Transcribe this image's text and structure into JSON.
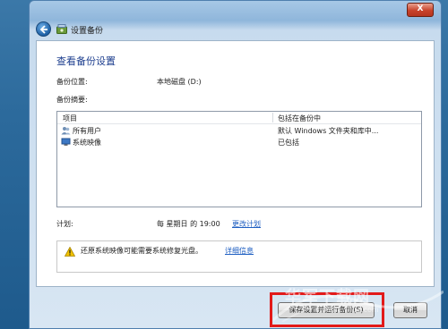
{
  "window": {
    "title": "设置备份",
    "close_label": "X"
  },
  "page": {
    "heading": "查看备份设置",
    "backup_location_label": "备份位置:",
    "backup_location_value": "本地磁盘 (D:)",
    "summary_label": "备份摘要:"
  },
  "list": {
    "col_item": "项目",
    "col_included": "包括在备份中",
    "rows": [
      {
        "name": "所有用户",
        "value": "默认 Windows 文件夹和库中...",
        "icon": "users-icon"
      },
      {
        "name": "系统映像",
        "value": "已包括",
        "icon": "system-image-icon"
      }
    ]
  },
  "schedule": {
    "label": "计划:",
    "value": "每 星期日 的 19:00",
    "change_link": "更改计划"
  },
  "warning": {
    "text": "还原系统映像可能需要系统修复光盘。",
    "link": "详细信息"
  },
  "buttons": {
    "save_run": "保存设置并运行备份(S)",
    "cancel": "取消"
  },
  "watermark": {
    "main": "华军下载网",
    "sub": "www.newhua.com"
  },
  "colors": {
    "heading": "#1e3f8f",
    "link": "#1f5fc2",
    "highlight": "#e21a1a"
  }
}
